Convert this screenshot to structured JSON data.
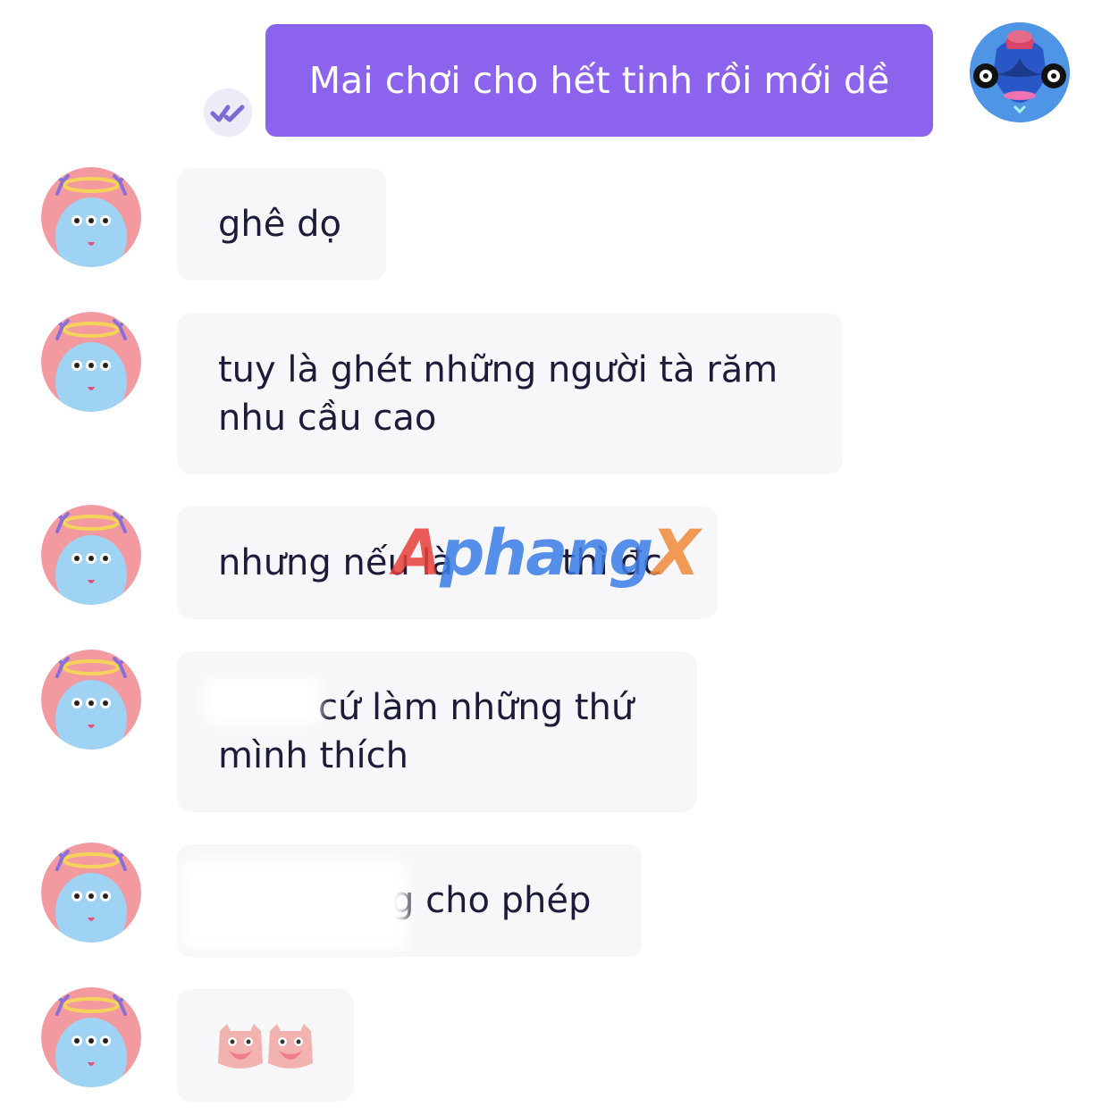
{
  "watermark": {
    "part1": "A",
    "part2": "phang",
    "part3": "X"
  },
  "outgoing": {
    "text": "Mai chơi cho hết tinh rồi mới dề",
    "seen_icon": "double-check-icon"
  },
  "messages": [
    {
      "text": "ghê dọ"
    },
    {
      "line1": "tuy là ghét những người tà răm",
      "line2": "nhu cầu cao"
    },
    {
      "part1": "nhưng nếu là",
      "part2": "thì đc"
    },
    {
      "part1": "cứ làm những thứ",
      "part2": "mình thích"
    },
    {
      "text": "g cho phép"
    },
    {
      "sticker": "owl-sticker-icon"
    }
  ],
  "colors": {
    "outgoing_bubble": "#8b63ec",
    "incoming_bubble": "#f7f7f9",
    "avatar_bg": "#f39aa0",
    "avatar_face": "#9fd3f4",
    "halo": "#f5d35a",
    "horns": "#8a6fd6"
  }
}
